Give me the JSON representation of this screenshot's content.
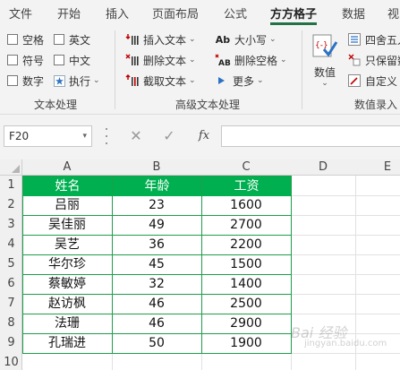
{
  "colors": {
    "accent_green": "#217346",
    "header_fill": "#00b050",
    "header_text": "#ffffff",
    "table_border": "#1e9e4a",
    "red_icon": "#c00000",
    "blue_icon": "#2b72c4"
  },
  "tabs": [
    {
      "label": "文件"
    },
    {
      "label": "开始"
    },
    {
      "label": "插入"
    },
    {
      "label": "页面布局"
    },
    {
      "label": "公式"
    },
    {
      "label": "方方格子",
      "active": true
    },
    {
      "label": "数据"
    },
    {
      "label": "视"
    }
  ],
  "ribbon": {
    "text_processing": {
      "label": "文本处理",
      "checkboxes": [
        {
          "label": "空格",
          "checked": false
        },
        {
          "label": "英文",
          "checked": false
        },
        {
          "label": "符号",
          "checked": false
        },
        {
          "label": "中文",
          "checked": false
        },
        {
          "label": "数字",
          "checked": false
        }
      ],
      "execute": {
        "label": "执行",
        "icon": "star-icon"
      }
    },
    "advanced_text": {
      "label": "高级文本处理",
      "buttons": [
        {
          "label": "插入文本",
          "icon": "insert-text-icon"
        },
        {
          "label": "删除文本",
          "icon": "delete-text-icon"
        },
        {
          "label": "截取文本",
          "icon": "extract-text-icon"
        },
        {
          "label": "大小写",
          "icon": "case-icon"
        },
        {
          "label": "删除空格",
          "icon": "remove-space-icon"
        },
        {
          "label": "更多",
          "icon": "more-icon"
        }
      ]
    },
    "numeric_entry": {
      "label": "数值录入",
      "big_button": {
        "label": "数值",
        "icon": "numeric-value-icon"
      },
      "buttons": [
        {
          "label": "四舍五入",
          "icon": "round-icon"
        },
        {
          "label": "只保留数",
          "icon": "keep-number-icon"
        },
        {
          "label": "自定义",
          "icon": "custom-icon"
        }
      ]
    }
  },
  "formula_bar": {
    "name_box": "F20",
    "cancel_symbol": "✕",
    "confirm_symbol": "✓",
    "fx_label": "fx",
    "formula": ""
  },
  "sheet": {
    "columns": [
      "A",
      "B",
      "C",
      "D",
      "E"
    ],
    "rows": [
      "1",
      "2",
      "3",
      "4",
      "5",
      "6",
      "7",
      "8",
      "9",
      "10"
    ],
    "table": {
      "headers": [
        "姓名",
        "年龄",
        "工资"
      ],
      "rows": [
        [
          "吕丽",
          "23",
          "1600"
        ],
        [
          "吴佳丽",
          "49",
          "2700"
        ],
        [
          "吴艺",
          "36",
          "2200"
        ],
        [
          "华尔珍",
          "45",
          "1500"
        ],
        [
          "蔡敏婷",
          "32",
          "1400"
        ],
        [
          "赵访枫",
          "46",
          "2500"
        ],
        [
          "法珊",
          "46",
          "2900"
        ],
        [
          "孔瑞进",
          "50",
          "1900"
        ]
      ]
    }
  },
  "watermark": {
    "text": "Bai 经验",
    "subtext": "jingyan.baidu.com"
  }
}
